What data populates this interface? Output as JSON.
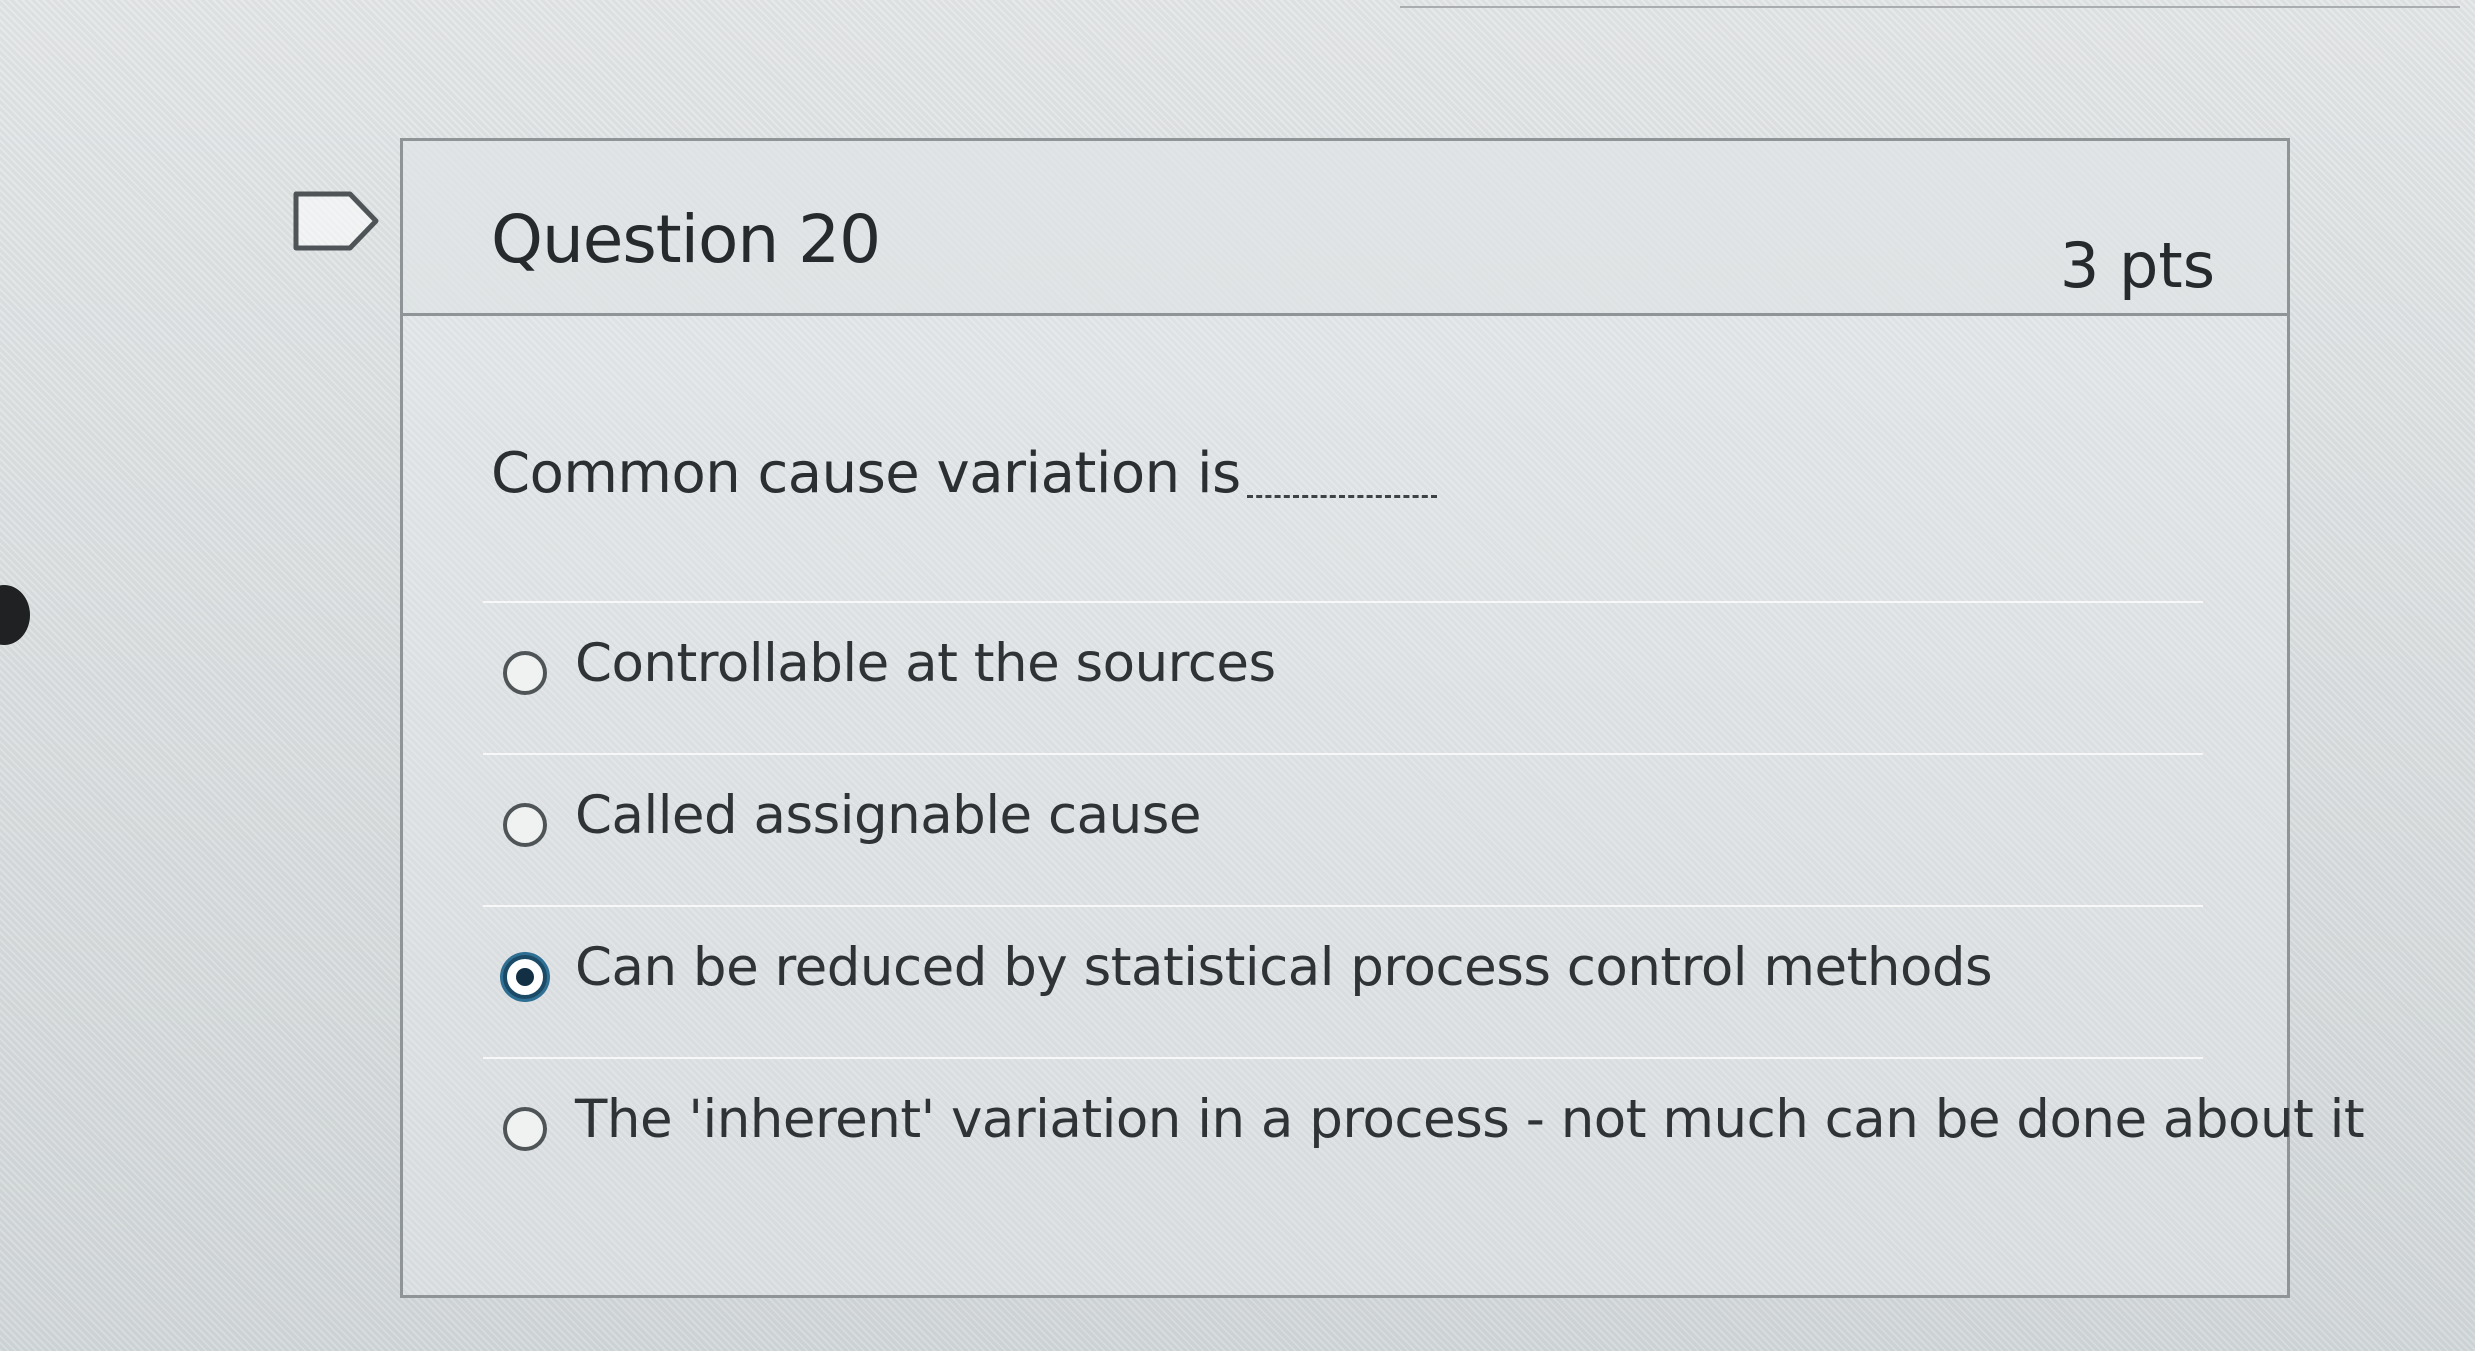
{
  "question": {
    "title": "Question 20",
    "points": "3 pts",
    "prompt": "Common cause variation is",
    "flag_icon": "flag-outline-icon"
  },
  "answers": [
    {
      "label": "Controllable at the sources",
      "selected": false
    },
    {
      "label": "Called assignable cause",
      "selected": false
    },
    {
      "label": "Can be reduced by statistical process control methods",
      "selected": true
    },
    {
      "label": "The 'inherent' variation in a process - not much can be done about it",
      "selected": false
    }
  ],
  "colors": {
    "card_border": "#8f9496",
    "text": "#262a2c",
    "selected_radio": "#2f6f94"
  }
}
